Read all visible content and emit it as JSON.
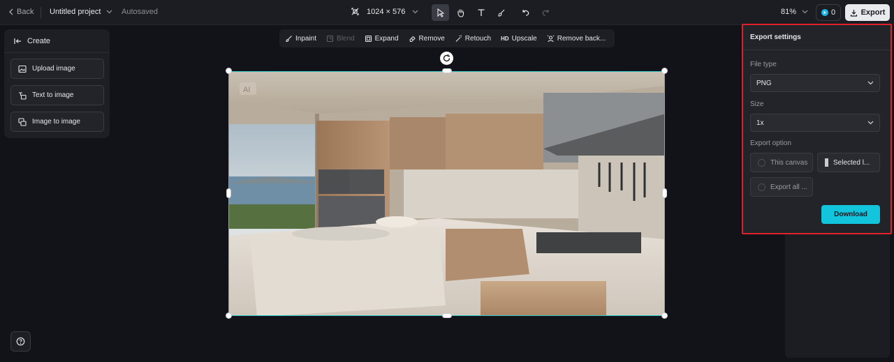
{
  "topbar": {
    "back_label": "Back",
    "project_name": "Untitled project",
    "save_status": "Autosaved",
    "canvas_size": "1024 × 576",
    "zoom": "81%",
    "credits": "0",
    "export_label": "Export"
  },
  "create_panel": {
    "title": "Create",
    "items": [
      {
        "label": "Upload image",
        "icon": "upload-image-icon"
      },
      {
        "label": "Text to image",
        "icon": "text-to-image-icon"
      },
      {
        "label": "Image to image",
        "icon": "image-to-image-icon"
      }
    ]
  },
  "canvas_tools": {
    "inpaint": "Inpaint",
    "blend": "Blend",
    "expand": "Expand",
    "remove": "Remove",
    "retouch": "Retouch",
    "upscale_badge": "HD",
    "upscale": "Upscale",
    "remove_background": "Remove back..."
  },
  "canvas": {
    "watermark": "AI",
    "selection_color": "#2ec8c8"
  },
  "export_settings": {
    "title": "Export settings",
    "file_type_label": "File type",
    "file_type_value": "PNG",
    "size_label": "Size",
    "size_value": "1x",
    "export_option_label": "Export option",
    "options": {
      "this_canvas": "This canvas",
      "selected_layers": "Selected l...",
      "export_all": "Export all ..."
    },
    "download_label": "Download",
    "accent_color": "#12c4dc",
    "highlight_color": "#e0202a"
  }
}
